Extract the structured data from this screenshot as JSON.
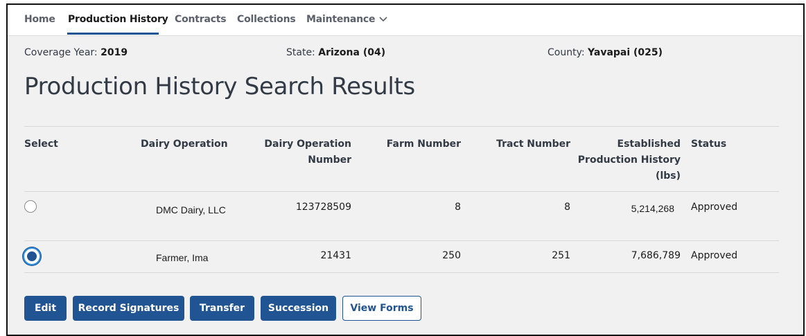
{
  "nav": {
    "home": "Home",
    "production_history": "Production History",
    "contracts": "Contracts",
    "collections": "Collections",
    "maintenance": "Maintenance",
    "maintenance_chevron": "chevron-down-icon"
  },
  "meta": {
    "coverage_year_label": "Coverage Year:",
    "coverage_year": "2019",
    "state_label": "State:",
    "state": "Arizona (04)",
    "county_label": "County:",
    "county": "Yavapai (025)"
  },
  "page_title": "Production History Search Results",
  "table": {
    "headers": {
      "select": "Select",
      "dairy_operation": "Dairy Operation",
      "dairy_operation_number_1": "Dairy Operation",
      "dairy_operation_number_2": "Number",
      "farm_number": "Farm Number",
      "tract_number": "Tract Number",
      "eph_1": "Established",
      "eph_2": "Production History",
      "eph_3": "(lbs)",
      "status": "Status"
    },
    "rows": [
      {
        "selected": false,
        "dairy_operation": "DMC Dairy, LLC",
        "dairy_operation_number": "123728509",
        "farm_number": "8",
        "tract_number": "8",
        "eph": "5,214,268",
        "status": "Approved"
      },
      {
        "selected": true,
        "dairy_operation": "Farmer, Ima",
        "dairy_operation_number": "21431",
        "farm_number": "250",
        "tract_number": "251",
        "eph": "7,686,789",
        "status": "Approved"
      }
    ]
  },
  "actions": {
    "edit": "Edit",
    "record_signatures": "Record Signatures",
    "transfer": "Transfer",
    "succession": "Succession",
    "view_forms": "View Forms"
  },
  "colors": {
    "primary": "#205493",
    "radio_focus": "#2e8ede"
  }
}
